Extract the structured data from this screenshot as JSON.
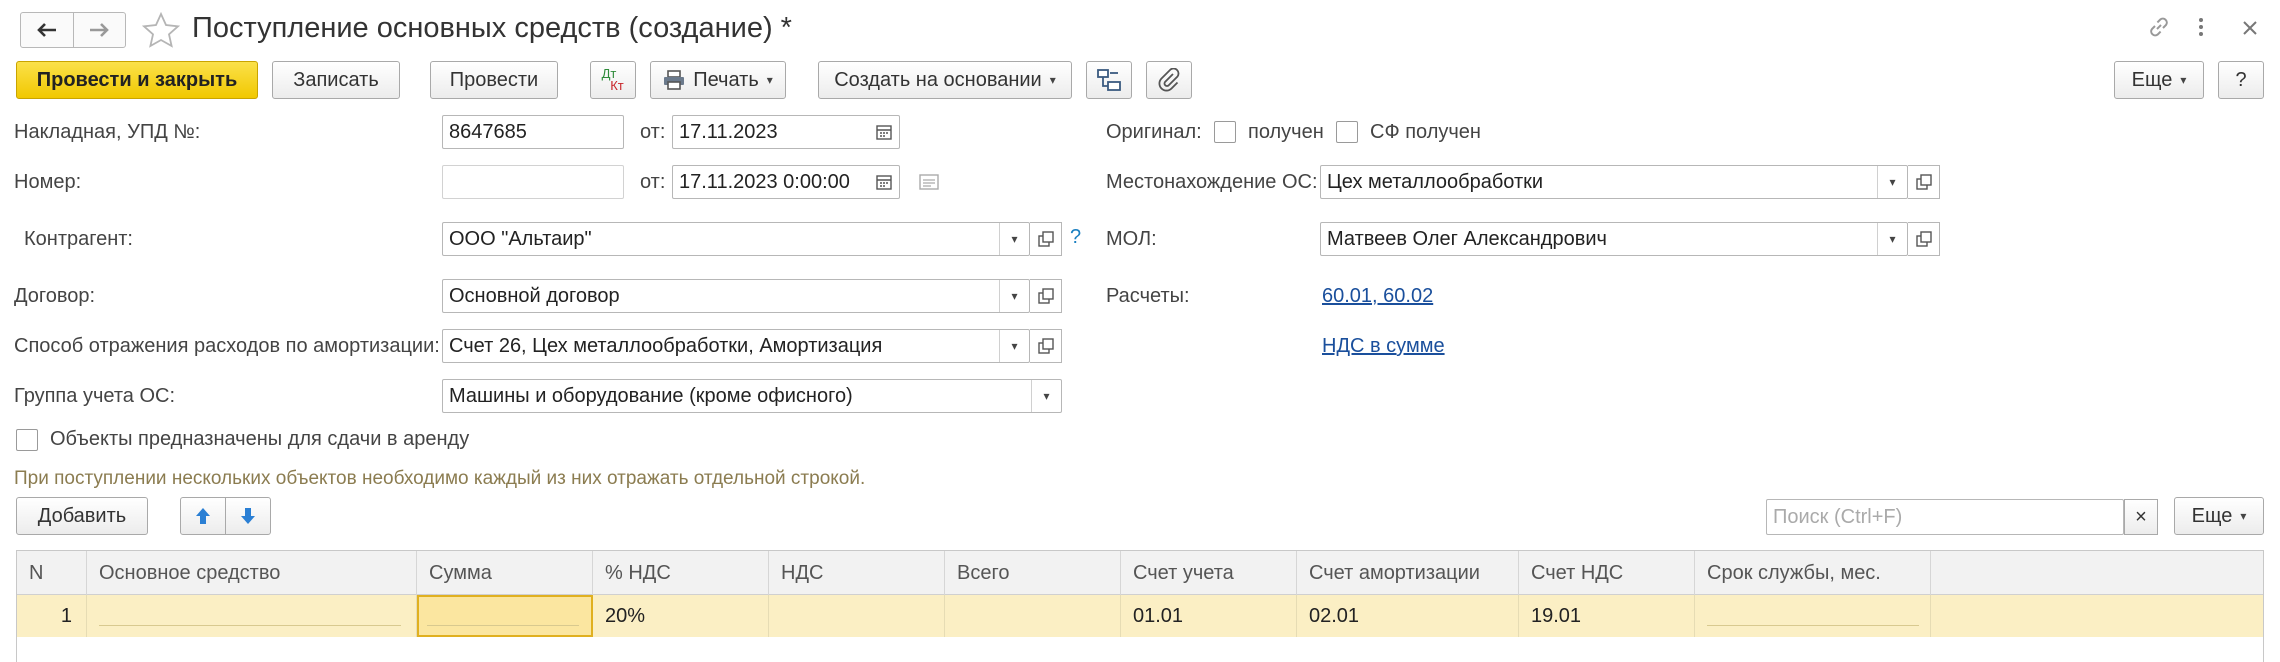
{
  "window": {
    "title": "Поступление основных средств (создание) *",
    "icons": [
      "arrow-left-icon",
      "arrow-right-icon",
      "star-icon",
      "link-icon",
      "more-vertical-icon",
      "close-icon"
    ]
  },
  "toolbar": {
    "post_and_close": "Провести и закрыть",
    "save": "Записать",
    "post": "Провести",
    "dt_kt_top": "Дт",
    "dt_kt_bottom": "Кт",
    "print": "Печать",
    "create_based_on": "Создать на основании",
    "more": "Еще",
    "help": "?"
  },
  "form": {
    "invoice_label": "Накладная, УПД №:",
    "invoice_number": "8647685",
    "from_label": "от:",
    "invoice_date": "17.11.2023",
    "number_label": "Номер:",
    "number_value": "",
    "from_label2": "от:",
    "doc_datetime": "17.11.2023  0:00:00",
    "counterparty_label": "Контрагент:",
    "counterparty_value": "ООО \"Альтаир\"",
    "counterparty_help": "?",
    "contract_label": "Договор:",
    "contract_value": "Основной договор",
    "amort_label": "Способ отражения расходов по амортизации:",
    "amort_value": "Счет 26, Цех металлообработки, Амортизация",
    "group_label": "Группа учета ОС:",
    "group_value": "Машины и оборудование (кроме офисного)",
    "rent_checkbox_label": "Объекты предназначены для сдачи в аренду",
    "rent_checked": false,
    "original_label": "Оригинал:",
    "received_label": "получен",
    "received_checked": false,
    "sf_received_label": "СФ получен",
    "sf_received_checked": false,
    "location_label": "Местонахождение ОС:",
    "location_value": "Цех металлообработки",
    "mol_label": "МОЛ:",
    "mol_value": "Матвеев Олег Александрович",
    "settlements_label": "Расчеты:",
    "settlements_link": "60.01, 60.02",
    "vat_link": "НДС в сумме",
    "hint": "При поступлении нескольких объектов необходимо каждый из них отражать отдельной строкой."
  },
  "table_toolbar": {
    "add": "Добавить",
    "search_placeholder": "Поиск (Ctrl+F)",
    "search_clear": "×",
    "more": "Еще"
  },
  "table": {
    "columns": [
      "N",
      "Основное средство",
      "Сумма",
      "% НДС",
      "НДС",
      "Всего",
      "Счет учета",
      "Счет амортизации",
      "Счет НДС",
      "Срок службы, мес."
    ],
    "rows": [
      {
        "n": "1",
        "asset": "",
        "sum": "",
        "vat_rate": "20%",
        "vat": "",
        "total": "",
        "account": "01.01",
        "amort_account": "02.01",
        "vat_account": "19.01",
        "life": ""
      }
    ]
  },
  "colors": {
    "primary_button": "#f5d10f",
    "link": "#1a4f9c",
    "hint": "#8b7c50",
    "selected_row": "#fbefc4"
  }
}
